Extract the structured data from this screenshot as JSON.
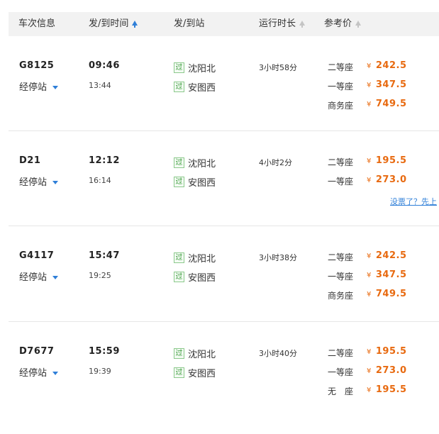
{
  "header": {
    "col_train": "车次信息",
    "col_time": "发/到时间",
    "col_station": "发/到站",
    "col_duration": "运行时长",
    "col_price": "参考价"
  },
  "currency": "¥",
  "stops_label": "经停站",
  "pass_badge": "过",
  "colors": {
    "price": "#e86a10",
    "link": "#2f7fd8",
    "badge": "#3a9a3a",
    "header_bg": "#f2f2f2"
  },
  "trains": [
    {
      "number": "G8125",
      "dep_time": "09:46",
      "arr_time": "13:44",
      "dep_station": "沈阳北",
      "arr_station": "安图西",
      "duration": "3小时58分",
      "seats": [
        {
          "name": "二等座",
          "price": "242.5"
        },
        {
          "name": "一等座",
          "price": "347.5"
        },
        {
          "name": "商务座",
          "price": "749.5"
        }
      ]
    },
    {
      "number": "D21",
      "dep_time": "12:12",
      "arr_time": "16:14",
      "dep_station": "沈阳北",
      "arr_station": "安图西",
      "duration": "4小时2分",
      "seats": [
        {
          "name": "二等座",
          "price": "195.5"
        },
        {
          "name": "一等座",
          "price": "273.0"
        }
      ],
      "note_link": "没票了？先上"
    },
    {
      "number": "G4117",
      "dep_time": "15:47",
      "arr_time": "19:25",
      "dep_station": "沈阳北",
      "arr_station": "安图西",
      "duration": "3小时38分",
      "seats": [
        {
          "name": "二等座",
          "price": "242.5"
        },
        {
          "name": "一等座",
          "price": "347.5"
        },
        {
          "name": "商务座",
          "price": "749.5"
        }
      ]
    },
    {
      "number": "D7677",
      "dep_time": "15:59",
      "arr_time": "19:39",
      "dep_station": "沈阳北",
      "arr_station": "安图西",
      "duration": "3小时40分",
      "seats": [
        {
          "name": "二等座",
          "price": "195.5"
        },
        {
          "name": "一等座",
          "price": "273.0"
        },
        {
          "name": "无　座",
          "price": "195.5"
        }
      ]
    }
  ]
}
